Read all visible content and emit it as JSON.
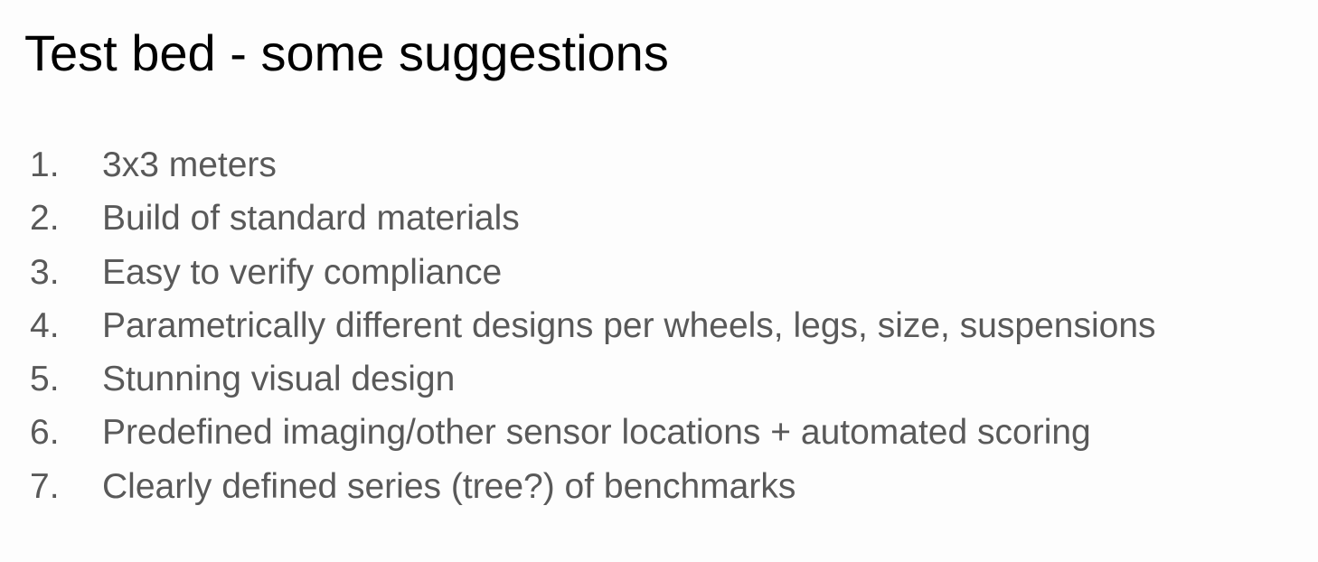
{
  "slide": {
    "title": "Test bed - some suggestions",
    "items": [
      {
        "number": "1.",
        "text": "3x3 meters"
      },
      {
        "number": "2.",
        "text": "Build of standard materials"
      },
      {
        "number": "3.",
        "text": "Easy to verify compliance"
      },
      {
        "number": "4.",
        "text": "Parametrically different designs per wheels, legs, size, suspensions"
      },
      {
        "number": "5.",
        "text": "Stunning visual design"
      },
      {
        "number": "6.",
        "text": "Predefined imaging/other sensor locations + automated scoring"
      },
      {
        "number": "7.",
        "text": "Clearly defined series (tree?) of benchmarks"
      }
    ]
  }
}
